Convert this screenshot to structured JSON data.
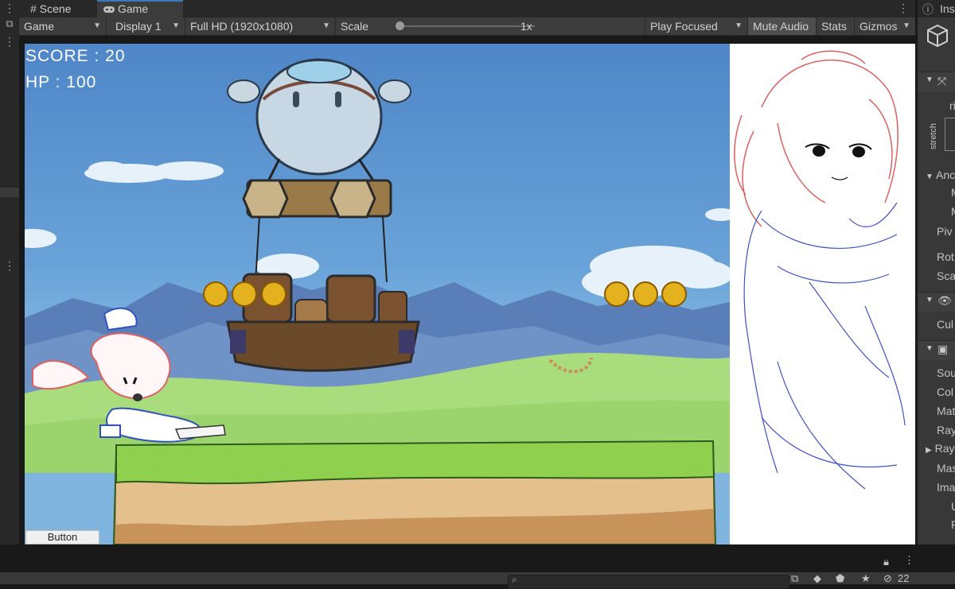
{
  "tabs": [
    {
      "label": "Scene",
      "icon": "hash-grid-icon",
      "active": false
    },
    {
      "label": "Game",
      "icon": "gamepad-icon",
      "active": true
    }
  ],
  "toolbar": {
    "display_mode": "Game",
    "display": "Display 1",
    "resolution": "Full HD (1920x1080)",
    "scale_label": "Scale",
    "scale_value": "1x",
    "play_mode": "Play Focused",
    "mute_audio": "Mute Audio",
    "stats": "Stats",
    "gizmos": "Gizmos"
  },
  "hud": {
    "score": "SCORE : 20",
    "hp": "HP : 100",
    "button_label": "Button"
  },
  "inspector": {
    "tab_label": "Ins",
    "rows": [
      "ri",
      "stretch",
      "Anc",
      "M",
      "M",
      "Piv",
      "Rot",
      "Sca",
      "Cul",
      "Sou",
      "Col",
      "Mat",
      "Ray",
      "Ray",
      "Mas",
      "Ima",
      "U",
      "P"
    ]
  },
  "status": {
    "hidden_count": "22"
  },
  "colors": {
    "accent": "#3a79bb",
    "coin": "#e3b21e",
    "grass": "#8fd04f",
    "dirt": "#c7935a"
  }
}
